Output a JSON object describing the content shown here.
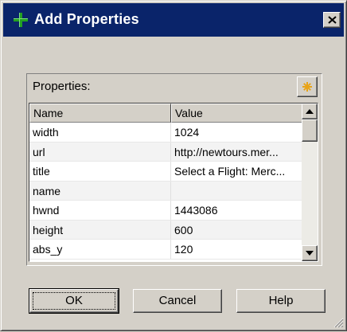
{
  "window": {
    "title": "Add Properties",
    "icon": "plus-icon",
    "close_icon": "close-icon"
  },
  "properties_panel": {
    "label": "Properties:",
    "add_button_icon": "asterisk-icon"
  },
  "grid": {
    "columns": [
      "Name",
      "Value"
    ],
    "rows": [
      {
        "name": "width",
        "value": "1024"
      },
      {
        "name": "url",
        "value": "http://newtours.mer..."
      },
      {
        "name": "title",
        "value": "Select a Flight: Merc..."
      },
      {
        "name": "name",
        "value": ""
      },
      {
        "name": "hwnd",
        "value": "1443086"
      },
      {
        "name": "height",
        "value": "600"
      },
      {
        "name": "abs_y",
        "value": "120"
      }
    ]
  },
  "buttons": {
    "ok": "OK",
    "cancel": "Cancel",
    "help": "Help"
  },
  "colors": {
    "titlebar": "#0a246a",
    "dialog_face": "#d4d0c8",
    "plus_icon": "#1a8a1a",
    "asterisk_icon": "#e8a317"
  }
}
